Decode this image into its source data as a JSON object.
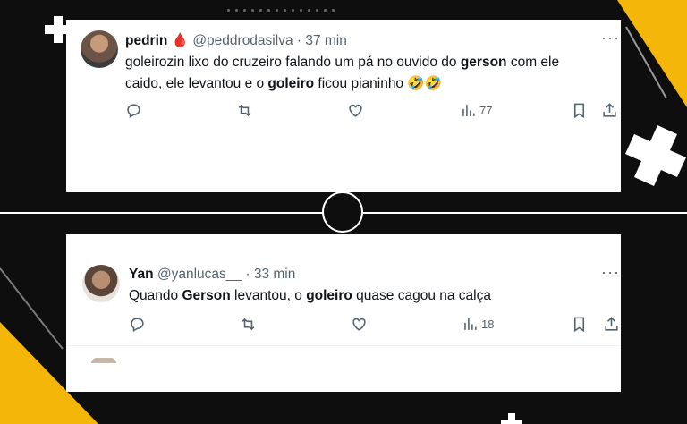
{
  "colors": {
    "accent": "#f5b60a",
    "text": "#0f1419",
    "muted": "#536471",
    "card": "#ffffff"
  },
  "tweet1": {
    "name": "pedrin",
    "badge": "🩸",
    "handle": "@peddrodasilva",
    "time": "· 37 min",
    "text_parts": [
      "goleirozin lixo do cruzeiro falando um pá no ouvido do ",
      "gerson",
      " com ele caido, ele levantou e o ",
      "goleiro",
      " ficou pianinho 🤣🤣"
    ],
    "views": "77",
    "more_icon": "more-dots-icon"
  },
  "tweet2": {
    "name": "Yan",
    "handle": "@yanlucas__",
    "time": "· 33 min",
    "text_parts": [
      "Quando ",
      "Gerson",
      " levantou, o ",
      "goleiro",
      " quase cagou na calça"
    ],
    "views": "18",
    "more_icon": "more-dots-icon"
  },
  "icons": [
    "reply-icon",
    "retweet-icon",
    "like-icon",
    "views-icon",
    "bookmark-icon",
    "share-icon"
  ]
}
